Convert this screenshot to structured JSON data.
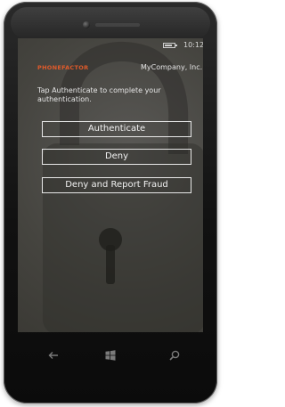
{
  "status_bar": {
    "time": "10:12"
  },
  "app": {
    "name": "PHONEFACTOR",
    "company": "MyCompany, Inc.",
    "instructions": "Tap Authenticate to complete your authentication."
  },
  "buttons": {
    "authenticate": "Authenticate",
    "deny": "Deny",
    "deny_report": "Deny and Report Fraud"
  },
  "icons": {
    "battery": "battery-icon",
    "back": "back-arrow-icon",
    "start": "windows-logo-icon",
    "search": "search-icon",
    "lock": "padlock-icon"
  },
  "colors": {
    "brand_orange": "#e05a2a",
    "button_border": "#e8e8e8"
  }
}
